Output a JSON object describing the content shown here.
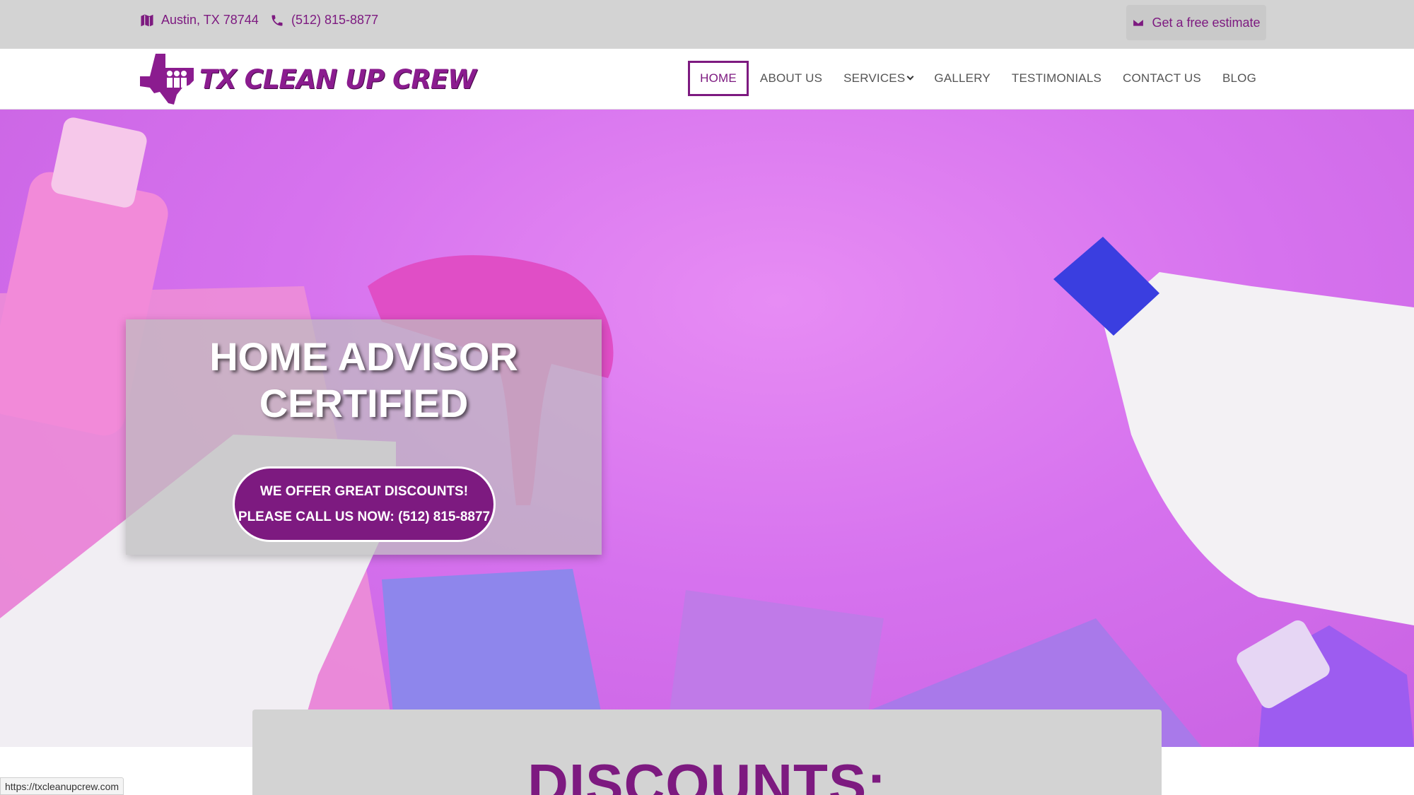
{
  "topbar": {
    "address": "Austin, TX 78744",
    "phone": "(512) 815-8877",
    "estimate_label": "Get a free estimate"
  },
  "brand": {
    "logo_text": "TX CLEAN UP CREW",
    "color": "#7d1a80"
  },
  "nav": {
    "items": [
      {
        "label": "HOME",
        "active": true
      },
      {
        "label": "ABOUT US"
      },
      {
        "label": "SERVICES",
        "has_dropdown": true
      },
      {
        "label": "GALLERY"
      },
      {
        "label": "TESTIMONIALS"
      },
      {
        "label": "CONTACT US"
      },
      {
        "label": "BLOG"
      }
    ]
  },
  "hero": {
    "heading_line1": "HOME ADVISOR",
    "heading_line2": "CERTIFIED",
    "cta_line1": "WE OFFER GREAT DISCOUNTS!",
    "cta_line2": "PLEASE CALL US NOW: (512) 815-8877"
  },
  "discounts": {
    "heading": "DISCOUNTS:"
  },
  "status": {
    "url": "https://txcleanupcrew.com"
  }
}
